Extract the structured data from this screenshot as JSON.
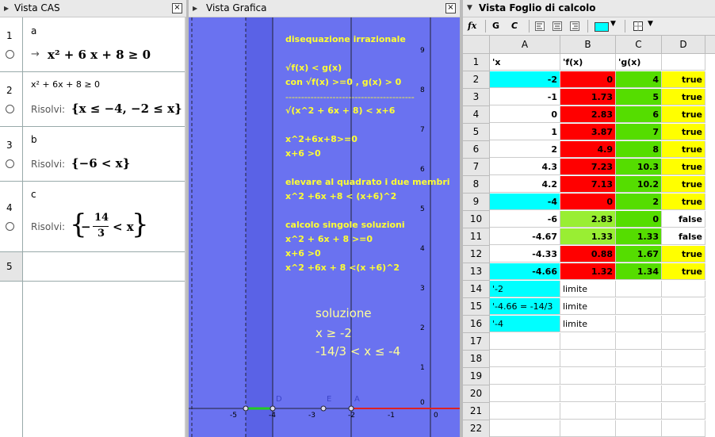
{
  "cas": {
    "title": "Vista CAS",
    "close": "×",
    "rows": [
      {
        "num": "1",
        "input": "a",
        "output": "x² + 6 x + 8 ≥ 0",
        "output_prefix": "→"
      },
      {
        "num": "2",
        "input": "x² + 6x + 8 ≥ 0",
        "label": "Risolvi:",
        "output": "{x ≤ −4, −2 ≤ x}"
      },
      {
        "num": "3",
        "input": "b",
        "label": "Risolvi:",
        "output": "{−6 < x}"
      },
      {
        "num": "4",
        "input": "c",
        "label": "Risolvi:",
        "output_num": "14",
        "output_den": "3",
        "output_minus": "−",
        "output_tail": "< x"
      },
      {
        "num": "5"
      }
    ]
  },
  "graphics": {
    "title": "Vista Grafica",
    "close": "×",
    "notes": [
      "disequazione irrazionale",
      "√f(x) < g(x)",
      "con √f(x) >=0 , g(x) > 0",
      "-----------------------------------------",
      "√(x^2 + 6x + 8) < x+6",
      "x^2+6x+8>=0",
      "x+6 >0",
      "elevare al quadrato i due membri",
      "x^2 +6x +8 < (x+6)^2",
      "calcolo singole soluzioni",
      "x^2 + 6x + 8 >=0",
      "x+6 >0",
      "x^2 +6x + 8 <(x +6)^2"
    ],
    "solution": [
      "soluzione",
      "x ≥ -2",
      "-14/3 < x ≤ -4"
    ],
    "x_ticks": [
      "-5",
      "-4",
      "-3",
      "-2",
      "-1",
      "0"
    ],
    "y_ticks": [
      "9",
      "8",
      "7",
      "6",
      "5",
      "4",
      "3",
      "2",
      "1",
      "0"
    ],
    "point_labels": [
      "D",
      "E",
      "A"
    ],
    "colors": {
      "background": "#6a72f0",
      "band": "#5a62e6",
      "text": "#ffff33",
      "green": "#22cc22",
      "red": "#dd2222"
    }
  },
  "spreadsheet": {
    "title": "Vista Foglio di calcolo",
    "toolbar": {
      "fx": "fx",
      "bold": "G",
      "italic": "C"
    },
    "columns": [
      "A",
      "B",
      "C",
      "D"
    ],
    "rows": [
      {
        "n": "1",
        "a": "'x",
        "b": "'f(x)",
        "c": "'g(x)",
        "d": ""
      },
      {
        "n": "2",
        "a": "-2",
        "b": "0",
        "c": "4",
        "d": "true"
      },
      {
        "n": "3",
        "a": "-1",
        "b": "1.73",
        "c": "5",
        "d": "true"
      },
      {
        "n": "4",
        "a": "0",
        "b": "2.83",
        "c": "6",
        "d": "true"
      },
      {
        "n": "5",
        "a": "1",
        "b": "3.87",
        "c": "7",
        "d": "true"
      },
      {
        "n": "6",
        "a": "2",
        "b": "4.9",
        "c": "8",
        "d": "true"
      },
      {
        "n": "7",
        "a": "4.3",
        "b": "7.23",
        "c": "10.3",
        "d": "true"
      },
      {
        "n": "8",
        "a": "4.2",
        "b": "7.13",
        "c": "10.2",
        "d": "true"
      },
      {
        "n": "9",
        "a": "-4",
        "b": "0",
        "c": "2",
        "d": "true"
      },
      {
        "n": "10",
        "a": "-6",
        "b": "2.83",
        "c": "0",
        "d": "false"
      },
      {
        "n": "11",
        "a": "-4.67",
        "b": "1.33",
        "c": "1.33",
        "d": "false"
      },
      {
        "n": "12",
        "a": "-4.33",
        "b": "0.88",
        "c": "1.67",
        "d": "true"
      },
      {
        "n": "13",
        "a": "-4.66",
        "b": "1.32",
        "c": "1.34",
        "d": "true"
      },
      {
        "n": "14",
        "a": "'-2",
        "b": "limite",
        "c": "",
        "d": ""
      },
      {
        "n": "15",
        "a": "'-4.66 = -14/3",
        "b": "limite",
        "c": "",
        "d": ""
      },
      {
        "n": "16",
        "a": "'-4",
        "b": "limite",
        "c": "",
        "d": ""
      },
      {
        "n": "17",
        "a": "",
        "b": "",
        "c": "",
        "d": ""
      },
      {
        "n": "18",
        "a": "",
        "b": "",
        "c": "",
        "d": ""
      },
      {
        "n": "19",
        "a": "",
        "b": "",
        "c": "",
        "d": ""
      },
      {
        "n": "20",
        "a": "",
        "b": "",
        "c": "",
        "d": ""
      },
      {
        "n": "21",
        "a": "",
        "b": "",
        "c": "",
        "d": ""
      },
      {
        "n": "22",
        "a": "",
        "b": "",
        "c": "",
        "d": ""
      }
    ],
    "colors": {
      "cyan": "#00ffff",
      "red": "#ff0000",
      "green": "#55dd00",
      "yellow": "#ffff00",
      "lightgreen": "#99ee33"
    }
  }
}
